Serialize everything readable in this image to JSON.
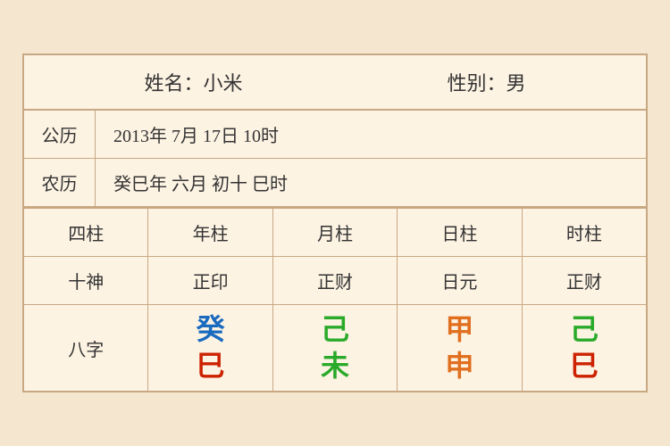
{
  "header": {
    "name_label": "姓名：小米",
    "gender_label": "性别：男"
  },
  "gregorian": {
    "label": "公历",
    "value": "2013年 7月 17日 10时"
  },
  "lunar": {
    "label": "农历",
    "value": "癸巳年 六月 初十 巳时"
  },
  "table": {
    "row_sizhu": {
      "label": "四柱",
      "cells": [
        "年柱",
        "月柱",
        "日柱",
        "时柱"
      ]
    },
    "row_shishen": {
      "label": "十神",
      "cells": [
        "正印",
        "正财",
        "日元",
        "正财"
      ]
    },
    "row_bazhi": {
      "label": "八字",
      "cells": [
        {
          "top": "癸",
          "bottom": "巳",
          "top_color": "blue",
          "bottom_color": "red"
        },
        {
          "top": "己",
          "bottom": "未",
          "top_color": "green",
          "bottom_color": "green"
        },
        {
          "top": "甲",
          "bottom": "申",
          "top_color": "orange",
          "bottom_color": "orange"
        },
        {
          "top": "己",
          "bottom": "巳",
          "top_color": "green2",
          "bottom_color": "red"
        }
      ]
    }
  },
  "colors": {
    "blue": "#1a6bbf",
    "green": "#2aaa2a",
    "orange": "#e07020",
    "red": "#cc2200"
  }
}
